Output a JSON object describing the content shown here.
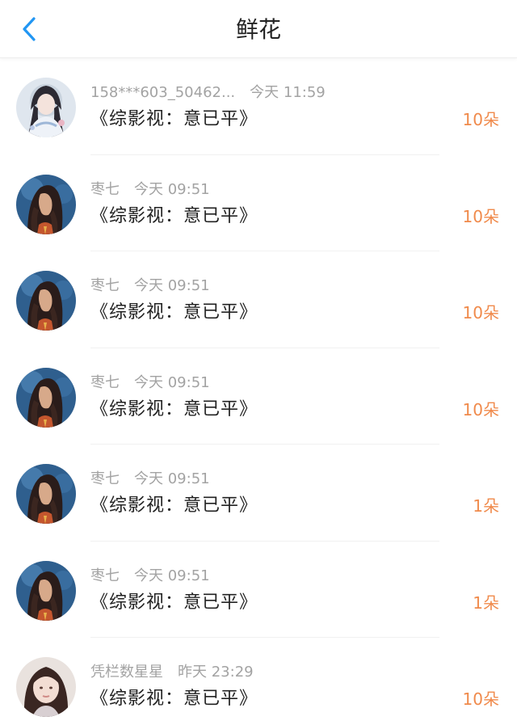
{
  "header": {
    "title": "鲜花",
    "back_icon": "chevron-left-icon",
    "accent_color": "#2196f3"
  },
  "colors": {
    "count": "#f08a4b",
    "meta": "#a3a3a3",
    "text": "#222222"
  },
  "rows": [
    {
      "user": "158***603_50462...",
      "time": "今天 11:59",
      "book": "《综影视：意已平》",
      "count": "10朵",
      "avatar": "avatar-girl-hanfu"
    },
    {
      "user": "枣七",
      "time": "今天 09:51",
      "book": "《综影视：意已平》",
      "count": "10朵",
      "avatar": "avatar-dark-hair-painting"
    },
    {
      "user": "枣七",
      "time": "今天 09:51",
      "book": "《综影视：意已平》",
      "count": "10朵",
      "avatar": "avatar-dark-hair-painting"
    },
    {
      "user": "枣七",
      "time": "今天 09:51",
      "book": "《综影视：意已平》",
      "count": "10朵",
      "avatar": "avatar-dark-hair-painting"
    },
    {
      "user": "枣七",
      "time": "今天 09:51",
      "book": "《综影视：意已平》",
      "count": "1朵",
      "avatar": "avatar-dark-hair-painting"
    },
    {
      "user": "枣七",
      "time": "今天 09:51",
      "book": "《综影视：意已平》",
      "count": "1朵",
      "avatar": "avatar-dark-hair-painting"
    },
    {
      "user": "凭栏数星星",
      "time": "昨天 23:29",
      "book": "《综影视：意已平》",
      "count": "10朵",
      "avatar": "avatar-girl-photo"
    }
  ]
}
